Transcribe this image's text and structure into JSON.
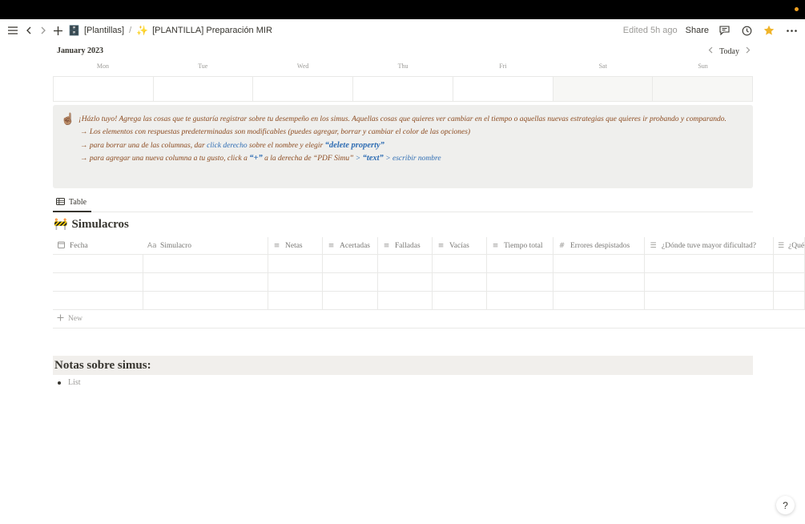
{
  "topbar": {
    "breadcrumbs": [
      {
        "icon": "cabinet-icon",
        "emoji": "🗄️",
        "label": "[Plantillas]"
      },
      {
        "icon": "sparkles-icon",
        "emoji": "✨",
        "label": "[PLANTILLA] Preparación MIR"
      }
    ],
    "separator": "/",
    "edited": "Edited 5h ago",
    "share": "Share"
  },
  "calendar": {
    "month": "January 2023",
    "today": "Today",
    "days": [
      "Mon",
      "Tue",
      "Wed",
      "Thu",
      "Fri",
      "Sat",
      "Sun"
    ]
  },
  "callout": {
    "emoji": "☝🏽",
    "line1": "¡Házlo tuyo! Agrega las cosas que te gustaría registrar sobre tu desempeño en los simus. Aquellas cosas que quieres ver cambiar en el tiempo o aquellas nuevas estrategias que quieres ir probando y comparando.",
    "line2": "→ Los elementos con respuestas predeterminadas son modificables (puedes agregar, borrar y cambiar el color de las opciones)",
    "line3_a": "→ para borrar una de las columnas, dar ",
    "line3_b": "click derecho",
    "line3_c": " sobre el nombre y elegir ",
    "line3_d": "“delete property”",
    "line4_a": "→ para agregar una nueva columna a tu gusto, click a ",
    "line4_b": "“+”",
    "line4_c": " a la derecha de “PDF Simu” ",
    "line4_d": "> ",
    "line4_e": "“text”",
    "line4_f": " > escribir nombre"
  },
  "view_tab": "Table",
  "database": {
    "emoji": "🚧",
    "title": "Simulacros",
    "columns": [
      {
        "icon": "▭",
        "label": "Fecha"
      },
      {
        "icon": "Aa",
        "label": "Simulacro"
      },
      {
        "icon": "≡",
        "label": "Netas"
      },
      {
        "icon": "≡",
        "label": "Acertadas"
      },
      {
        "icon": "≡",
        "label": "Falladas"
      },
      {
        "icon": "≡",
        "label": "Vacías"
      },
      {
        "icon": "≡",
        "label": "Tiempo total"
      },
      {
        "icon": "#",
        "label": "Errores despistados"
      },
      {
        "icon": "☰",
        "label": "¿Dónde tuve mayor dificultad?"
      },
      {
        "icon": "☰",
        "label": "¿Qué"
      }
    ],
    "new_label": "New"
  },
  "notes": {
    "heading": "Notas sobre simus:",
    "list_placeholder": "List"
  },
  "help": "?"
}
